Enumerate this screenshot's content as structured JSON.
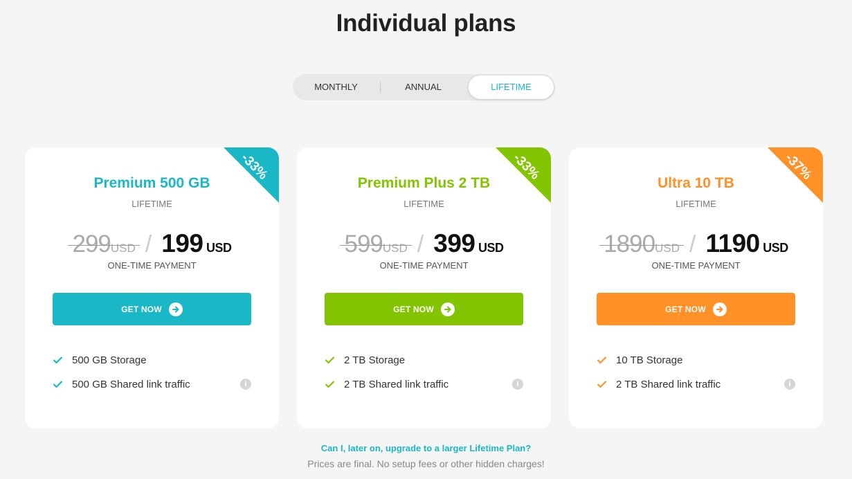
{
  "page": {
    "title": "Individual plans"
  },
  "toggle": {
    "options": [
      "MONTHLY",
      "ANNUAL",
      "LIFETIME"
    ],
    "selected": "LIFETIME"
  },
  "colors": {
    "premium": "#1ab8c6",
    "plus": "#83c400",
    "ultra": "#ff9126"
  },
  "plans": [
    {
      "name": "Premium 500 GB",
      "period": "LIFETIME",
      "discount": "-33%",
      "old_price": "299",
      "new_price": "199",
      "currency": "USD",
      "payment_note": "ONE-TIME PAYMENT",
      "cta": "GET NOW",
      "features": [
        "500 GB Storage",
        "500 GB Shared link traffic"
      ]
    },
    {
      "name": "Premium Plus 2 TB",
      "period": "LIFETIME",
      "discount": "-33%",
      "old_price": "599",
      "new_price": "399",
      "currency": "USD",
      "payment_note": "ONE-TIME PAYMENT",
      "cta": "GET NOW",
      "features": [
        "2 TB Storage",
        "2 TB Shared link traffic"
      ]
    },
    {
      "name": "Ultra 10 TB",
      "period": "LIFETIME",
      "discount": "-37%",
      "old_price": "1890",
      "new_price": "1190",
      "currency": "USD",
      "payment_note": "ONE-TIME PAYMENT",
      "cta": "GET NOW",
      "features": [
        "10 TB Storage",
        "2 TB Shared link traffic"
      ]
    }
  ],
  "footer": {
    "faq_link": "Can I, later on, upgrade to a larger Lifetime Plan?",
    "note": "Prices are final. No setup fees or other hidden charges!"
  },
  "icons": {
    "check": "check-icon",
    "info": "info-icon",
    "arrow": "arrow-right-circle-icon"
  }
}
